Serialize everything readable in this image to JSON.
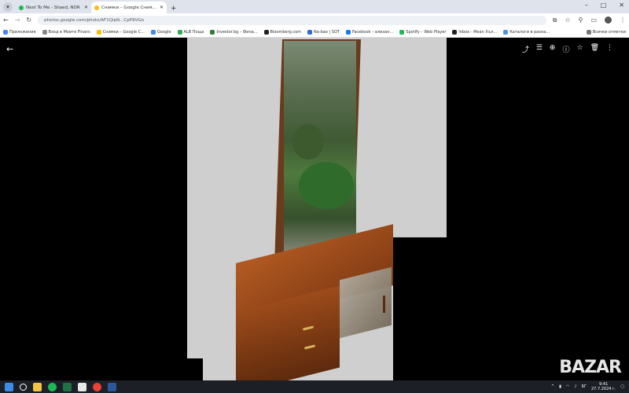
{
  "browser": {
    "tabs": [
      {
        "title": "Next To Me - Shaed, NOR",
        "favicon_color": "#1db954",
        "active": false
      },
      {
        "title": "Снимки – Google Снимки",
        "favicon_color": "#fbbc04",
        "active": true
      }
    ],
    "new_tab_label": "+",
    "url": "photos.google.com/photo/AF1QipN...CpP9VGo",
    "window_controls": [
      "–",
      "□",
      "✕"
    ]
  },
  "bookmarks": {
    "items": [
      {
        "label": "Приложения",
        "color": "#4285f4"
      },
      {
        "label": "Вход в Моите Finans",
        "color": "#888888"
      },
      {
        "label": "Снимки – Google С...",
        "color": "#fbbc04"
      },
      {
        "label": "Google",
        "color": "#4285f4"
      },
      {
        "label": "ALB Поща",
        "color": "#34a853"
      },
      {
        "label": "Investor.bg – Фина...",
        "color": "#2e7d32"
      },
      {
        "label": "Bloomberg.com",
        "color": "#222222"
      },
      {
        "label": "Na-bao | SOT",
        "color": "#3367d6"
      },
      {
        "label": "Facebook – влизан...",
        "color": "#1877f2"
      },
      {
        "label": "Spotify – Web Player",
        "color": "#1db954"
      },
      {
        "label": "Inbox - Mean Хъл...",
        "color": "#222222"
      },
      {
        "label": "Каталоги в разна...",
        "color": "#4a90e2"
      }
    ],
    "all_label": "Всички отметки"
  },
  "viewer": {
    "back_icon": "arrow-left-icon",
    "tools": [
      "share-icon",
      "tune-icon",
      "zoom-icon",
      "info-icon",
      "star-icon",
      "delete-icon",
      "more-icon"
    ],
    "watermark": "BAZAR"
  },
  "taskbar": {
    "apps": [
      {
        "name": "search-icon",
        "color": "#ffffff"
      },
      {
        "name": "file-explorer-icon",
        "color": "#f4c542"
      },
      {
        "name": "spotify-icon",
        "color": "#1db954"
      },
      {
        "name": "excel-icon",
        "color": "#1e7145"
      },
      {
        "name": "files-icon",
        "color": "#e8e8e8"
      },
      {
        "name": "chrome-icon",
        "color": "#e94235"
      },
      {
        "name": "word-icon",
        "color": "#2b579a"
      }
    ],
    "lang": "БГ",
    "time": "9:41",
    "date": "27.7.2024 г."
  }
}
